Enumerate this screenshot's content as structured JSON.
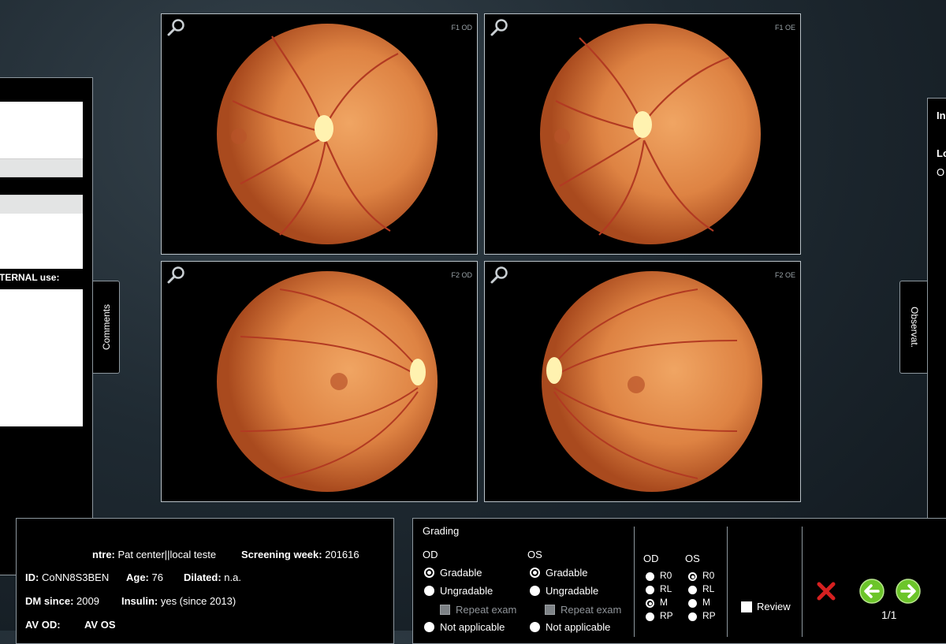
{
  "left_panel": {
    "internal_label": "TERNAL use:",
    "comments_tab": "Comments"
  },
  "right_panel": {
    "observ_tab": "Observat.",
    "line1": "In",
    "line2": "Lo",
    "line3": "O"
  },
  "images": [
    {
      "label": "F1 OD"
    },
    {
      "label": "F1 OE"
    },
    {
      "label": "F2 OD"
    },
    {
      "label": "F2 OE"
    }
  ],
  "info": {
    "centre_label": "ntre:",
    "centre_value": "Pat center||local teste",
    "week_label": "Screening week:",
    "week_value": "201616",
    "id_label": "ID:",
    "id_value": "CoNN8S3BEN",
    "age_label": "Age:",
    "age_value": "76",
    "dilated_label": "Dilated:",
    "dilated_value": "n.a.",
    "dm_label": "DM since:",
    "dm_value": "2009",
    "insulin_label": "Insulin:",
    "insulin_value": "yes (since 2013)",
    "av_od_label": "AV OD:",
    "av_os_label": "AV OS"
  },
  "grading": {
    "title": "Grading",
    "od_header": "OD",
    "os_header": "OS",
    "gradable": "Gradable",
    "ungradable": "Ungradable",
    "repeat_exam": "Repeat exam",
    "not_applicable": "Not applicable",
    "od_selected": "Gradable",
    "os_selected": "Gradable",
    "retino": {
      "od_header": "OD",
      "os_header": "OS",
      "options": [
        "R0",
        "RL",
        "M",
        "RP"
      ],
      "od_selected": [
        "R0",
        "M"
      ],
      "os_selected": [
        "R0",
        "M"
      ]
    },
    "review_label": "Review",
    "page_indicator": "1/1"
  },
  "colors": {
    "reject": "#d62020",
    "nav": "#6cc52a"
  },
  "icons": [
    "magnifier-icon",
    "close-icon",
    "arrow-left-icon",
    "arrow-right-icon"
  ]
}
